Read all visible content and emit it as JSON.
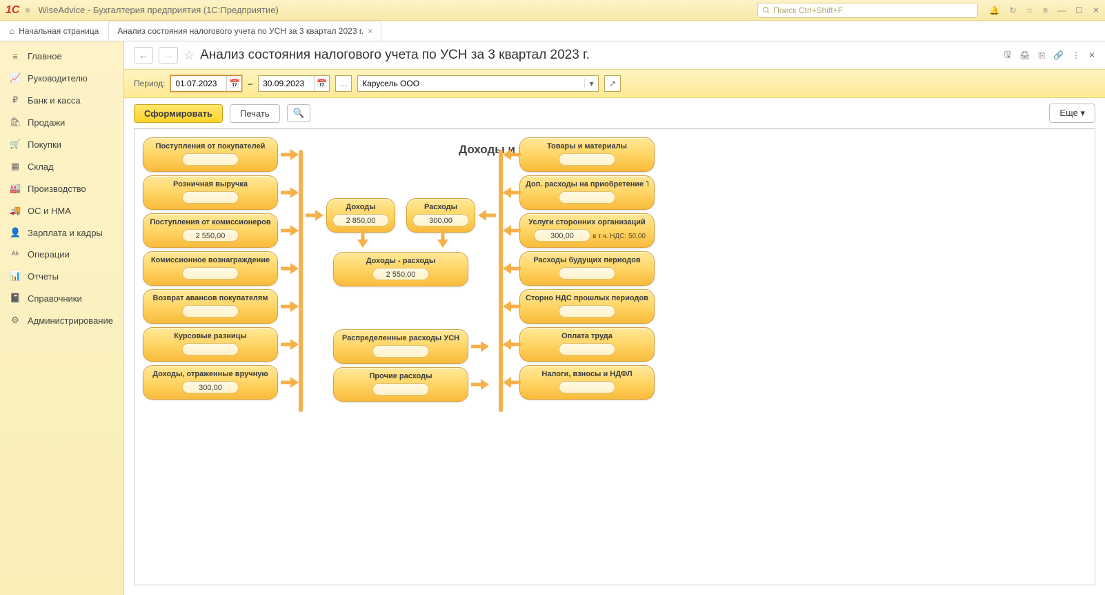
{
  "app": {
    "title": "WiseAdvice - Бухгалтерия предприятия  (1С:Предприятие)",
    "search_placeholder": "Поиск Ctrl+Shift+F"
  },
  "tabs": {
    "home": "Начальная страница",
    "active": "Анализ состояния налогового учета по УСН за 3 квартал 2023 г."
  },
  "nav": [
    "Главное",
    "Руководителю",
    "Банк и касса",
    "Продажи",
    "Покупки",
    "Склад",
    "Производство",
    "ОС и НМА",
    "Зарплата и кадры",
    "Операции",
    "Отчеты",
    "Справочники",
    "Администрирование"
  ],
  "header": {
    "page_title": "Анализ состояния налогового учета по УСН за 3 квартал 2023 г."
  },
  "params": {
    "period_label": "Период:",
    "date_from": "01.07.2023",
    "date_to": "30.09.2023",
    "dash": "–",
    "org": "Карусель ООО"
  },
  "actions": {
    "form": "Сформировать",
    "print": "Печать",
    "more": "Еще"
  },
  "report": {
    "title": "Доходы и расходы УСН",
    "left": [
      {
        "title": "Поступления от покупателей",
        "value": ""
      },
      {
        "title": "Розничная выручка",
        "value": ""
      },
      {
        "title": "Поступления от комиссионеров",
        "value": "2 550,00"
      },
      {
        "title": "Комиссионное вознаграждение",
        "value": ""
      },
      {
        "title": "Возврат авансов покупателям",
        "value": ""
      },
      {
        "title": "Курсовые разницы",
        "value": ""
      },
      {
        "title": "Доходы, отраженные вручную",
        "value": "300,00"
      }
    ],
    "center_top": [
      {
        "title": "Доходы",
        "value": "2 850,00"
      },
      {
        "title": "Расходы",
        "value": "300,00"
      }
    ],
    "center_mid": {
      "title": "Доходы - расходы",
      "value": "2 550,00"
    },
    "center_bottom": [
      {
        "title": "Распределенные расходы УСН",
        "value": ""
      },
      {
        "title": "Прочие расходы",
        "value": ""
      }
    ],
    "right": [
      {
        "title": "Товары и материалы",
        "value": ""
      },
      {
        "title": "Доп. расходы на приобретение ТМЦ",
        "value": ""
      },
      {
        "title": "Услуги сторонних организаций",
        "value": "300,00",
        "note": "в т.ч. НДС: 50,00"
      },
      {
        "title": "Расходы будущих периодов",
        "value": ""
      },
      {
        "title": "Сторно НДС прошлых периодов",
        "value": ""
      },
      {
        "title": "Оплата труда",
        "value": ""
      },
      {
        "title": "Налоги, взносы и НДФЛ",
        "value": ""
      }
    ]
  }
}
